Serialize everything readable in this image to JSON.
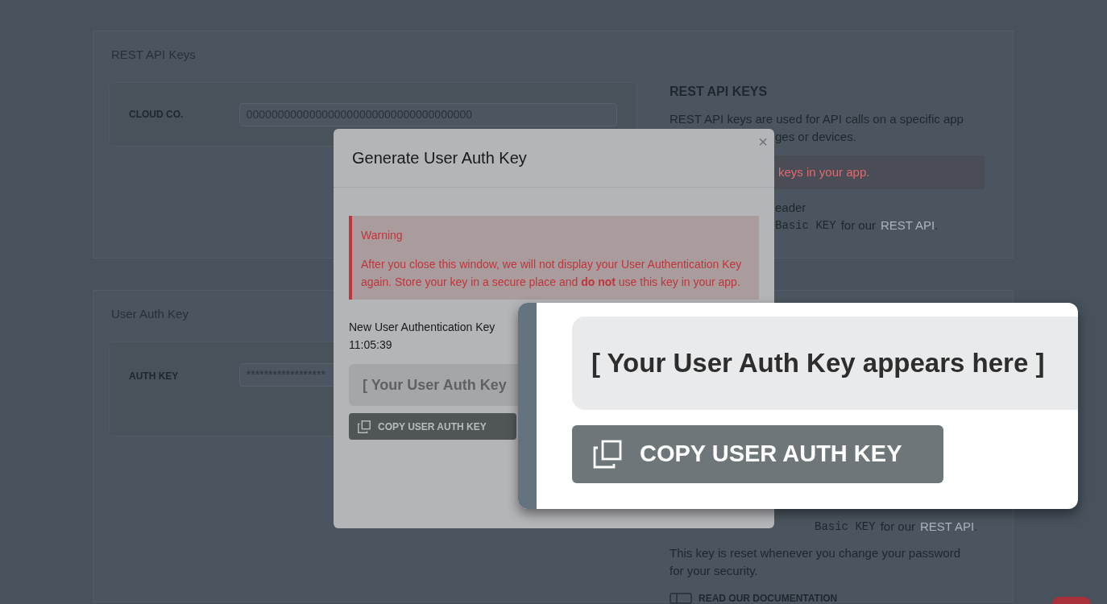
{
  "rest_api_keys": {
    "heading": "REST API Keys",
    "field": {
      "label": "CLOUD CO.",
      "value": "000000000000000000000000000000000000"
    },
    "info": {
      "title": "REST API KEYS",
      "items": [
        {
          "kind": "paragraph",
          "text": "REST API keys are used for API calls on a specific app"
        },
        {
          "kind": "fragment",
          "text": "ges or devices."
        },
        {
          "kind": "alert",
          "text": "keys in your app."
        },
        {
          "kind": "fragment",
          "text": "eader"
        },
        {
          "kind": "code_line",
          "code": "Basic KEY",
          "text": "for our",
          "link": "REST API",
          "tail": "."
        }
      ]
    }
  },
  "user_auth_key": {
    "heading": "User Auth Key",
    "field": {
      "label": "AUTH KEY",
      "value": "******************"
    },
    "info": {
      "items": [
        {
          "kind": "code_line",
          "code": "Basic KEY",
          "text": "for our",
          "link": "REST API",
          "tail": "."
        },
        {
          "kind": "paragraph",
          "text": "This key is reset whenever you change your password for your security."
        },
        {
          "kind": "doc_link",
          "text": "READ OUR DOCUMENTATION"
        }
      ]
    }
  },
  "modal": {
    "title": "Generate User Auth Key",
    "close": "×",
    "warning": {
      "title": "Warning",
      "text": "After you close this window, we will not display your User Authentication Key again. Store your key in a secure place and **do not** use this key in your app."
    },
    "generated_label": "New User Authentication Key",
    "generated_time": "11:05:39",
    "key_placeholder": "[ Your User Auth Key",
    "copy_button": "COPY USER AUTH KEY"
  },
  "callout": {
    "key_placeholder": "[ Your User Auth Key appears here ]",
    "copy_button": "COPY USER AUTH KEY"
  }
}
